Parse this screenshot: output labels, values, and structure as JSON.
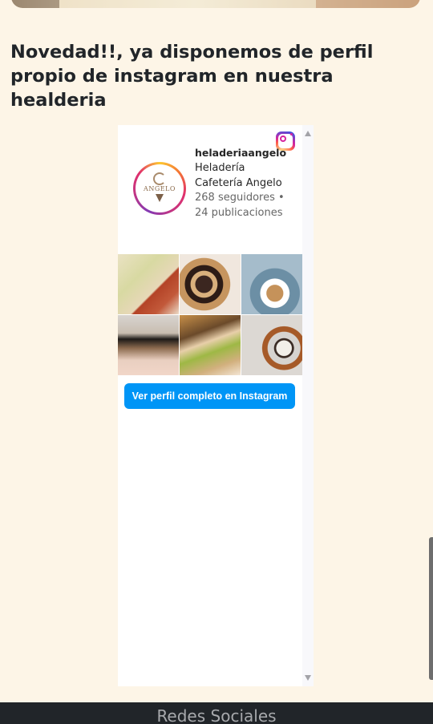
{
  "headline": "Novedad!!, ya disponemos de perfil propio de instagram en nuestra healderia",
  "instagram": {
    "username": "heladeriaangelo",
    "full_name": "Heladería Cafetería Angelo",
    "stats": "268 seguidores • 24 publicaciones",
    "avatar_text": "ANGELO",
    "cta_label": "Ver perfil completo en Instagram",
    "posts": [
      "post-1",
      "post-2",
      "post-3",
      "post-4",
      "post-5",
      "post-6"
    ]
  },
  "footer": {
    "title": "Redes Sociales"
  },
  "colors": {
    "page_background": "#fdf5e7",
    "cta": "#0095f6",
    "footer": "#212529"
  }
}
